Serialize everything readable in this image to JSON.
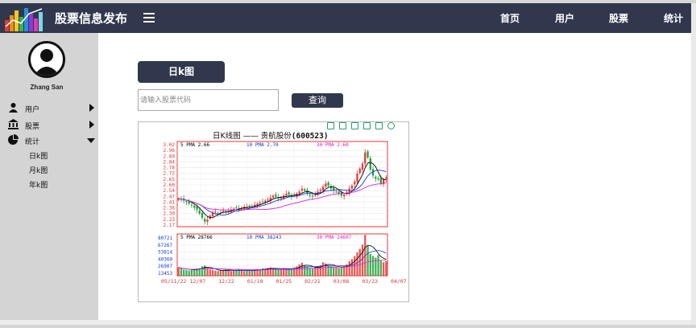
{
  "header": {
    "brand": "股票信息发布",
    "nav": [
      "首页",
      "用户",
      "股票",
      "统计"
    ],
    "menu_icon": "hamburger-icon",
    "logo_icon": "bar-chart-logo-icon"
  },
  "sidebar": {
    "user_name": "Zhang San",
    "avatar_icon": "user-avatar-icon",
    "items": [
      {
        "label": "用户",
        "icon": "user-icon",
        "expanded": false
      },
      {
        "label": "股票",
        "icon": "bank-icon",
        "expanded": false
      },
      {
        "label": "统计",
        "icon": "pie-chart-icon",
        "expanded": true
      }
    ],
    "subitems": [
      "日k图",
      "月k图",
      "年k图"
    ]
  },
  "main": {
    "tab_label": "日k图",
    "search_placeholder": "请输入股票代码",
    "search_value": "",
    "query_label": "查询"
  },
  "colors": {
    "header_bg": "#31384d",
    "sidebar_bg": "#d4d4d4",
    "up": "#e53935",
    "down": "#1fa23a",
    "ma5": "#000000",
    "ma10": "#1a3bd6",
    "ma30": "#e021d6"
  },
  "chart_data": {
    "type": "candlestick",
    "title_prefix": "日K线图 —— 贵航股份",
    "title_code": "(600523)",
    "price_panel": {
      "ma_labels": [
        "5 PMA 2.66",
        "10 PMA 2.70",
        "30 PMA 2.60"
      ],
      "ylim": [
        2.17,
        3.02
      ],
      "yticks": [
        "3.02",
        "2.96",
        "2.89",
        "2.84",
        "2.78",
        "2.72",
        "2.65",
        "2.60",
        "2.54",
        "2.47",
        "2.41",
        "2.36",
        "2.30",
        "2.23",
        "2.17"
      ]
    },
    "volume_panel": {
      "ma_labels": [
        "5 PMA 28766",
        "10 PMA 38243",
        "30 PMA 24607"
      ],
      "ylim": [
        0,
        80721
      ],
      "yticks": [
        "80721",
        "67267",
        "53814",
        "40360",
        "26907",
        "13453"
      ]
    },
    "xticks": [
      "05/11/22",
      "12/07",
      "12/22",
      "01/10",
      "01/25",
      "02/21",
      "03/08",
      "03/23",
      "04/07"
    ],
    "close": [
      2.45,
      2.44,
      2.43,
      2.42,
      2.4,
      2.38,
      2.36,
      2.34,
      2.3,
      2.26,
      2.22,
      2.24,
      2.28,
      2.31,
      2.32,
      2.3,
      2.31,
      2.33,
      2.32,
      2.33,
      2.34,
      2.35,
      2.36,
      2.35,
      2.36,
      2.37,
      2.36,
      2.38,
      2.37,
      2.39,
      2.4,
      2.41,
      2.42,
      2.43,
      2.44,
      2.46,
      2.48,
      2.47,
      2.45,
      2.46,
      2.48,
      2.5,
      2.49,
      2.47,
      2.48,
      2.5,
      2.52,
      2.55,
      2.53,
      2.5,
      2.48,
      2.47,
      2.5,
      2.52,
      2.54,
      2.57,
      2.6,
      2.58,
      2.55,
      2.53,
      2.52,
      2.5,
      2.48,
      2.49,
      2.51,
      2.55,
      2.58,
      2.62,
      2.7,
      2.75,
      2.8,
      2.91,
      2.86,
      2.74,
      2.68,
      2.65,
      2.64,
      2.6,
      2.64,
      2.66
    ],
    "volume": [
      16000,
      14000,
      12000,
      11000,
      10000,
      12000,
      13000,
      14000,
      15000,
      18000,
      20000,
      14000,
      12000,
      11000,
      10000,
      9000,
      10000,
      11000,
      12000,
      10000,
      9000,
      10000,
      11000,
      12000,
      10000,
      9000,
      10000,
      11000,
      10000,
      12000,
      13000,
      12000,
      14000,
      13000,
      15000,
      16000,
      14000,
      13000,
      12000,
      14000,
      15000,
      13000,
      12000,
      14000,
      16000,
      18000,
      22000,
      25000,
      20000,
      17000,
      15000,
      14000,
      16000,
      18000,
      20000,
      26000,
      24000,
      20000,
      18000,
      17000,
      16000,
      15000,
      17000,
      19000,
      22000,
      28000,
      32000,
      38000,
      45000,
      52000,
      60000,
      79000,
      58000,
      42000,
      38000,
      35000,
      40000,
      30000,
      26000,
      28000
    ]
  }
}
